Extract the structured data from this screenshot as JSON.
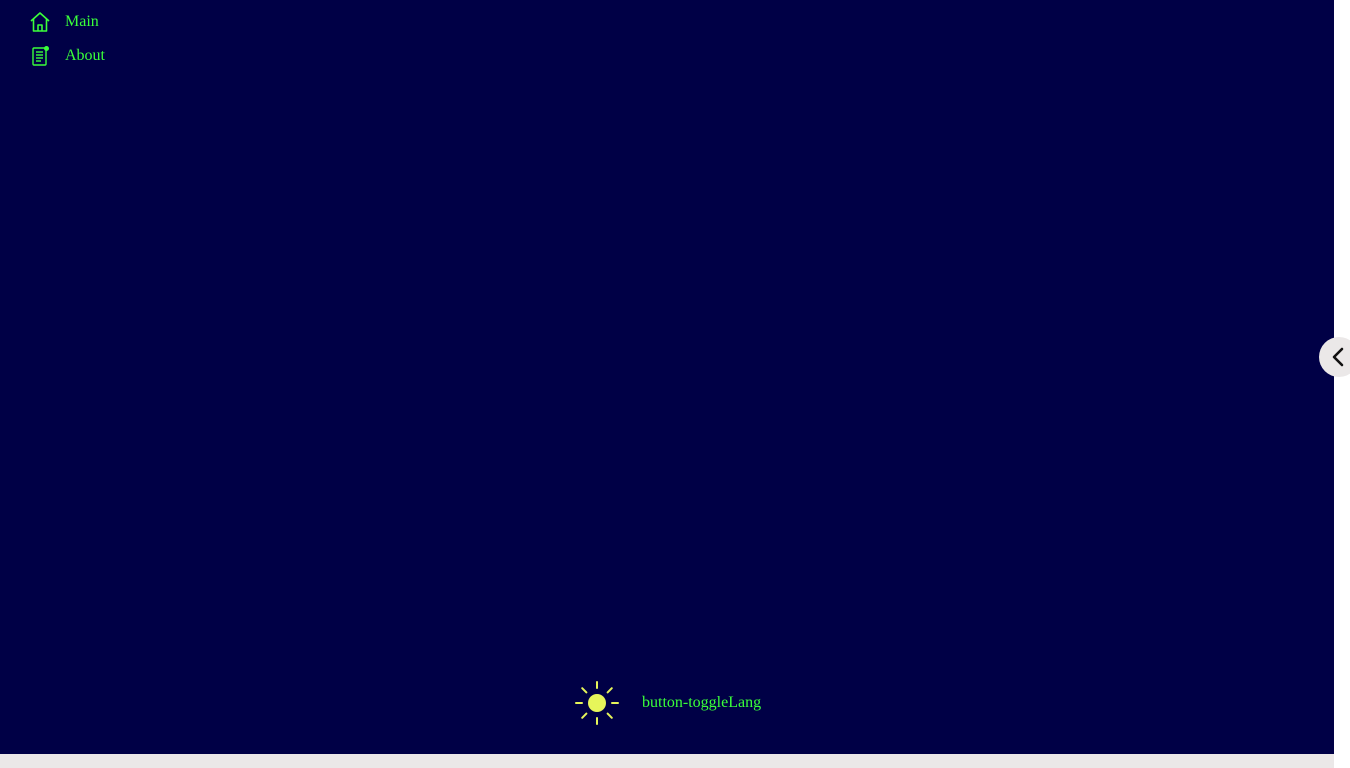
{
  "nav": {
    "items": [
      {
        "label": "Main",
        "icon": "home-icon"
      },
      {
        "label": "About",
        "icon": "document-icon"
      }
    ]
  },
  "footer": {
    "theme_toggle_icon": "sun-icon",
    "lang_toggle_label": "button-toggleLang"
  },
  "sidebar_toggle": {
    "icon": "chevron-left-icon"
  },
  "colors": {
    "background": "#000046",
    "accent": "#3aff3a",
    "sun": "#e6f55a",
    "panel": "#ebe8e8"
  }
}
